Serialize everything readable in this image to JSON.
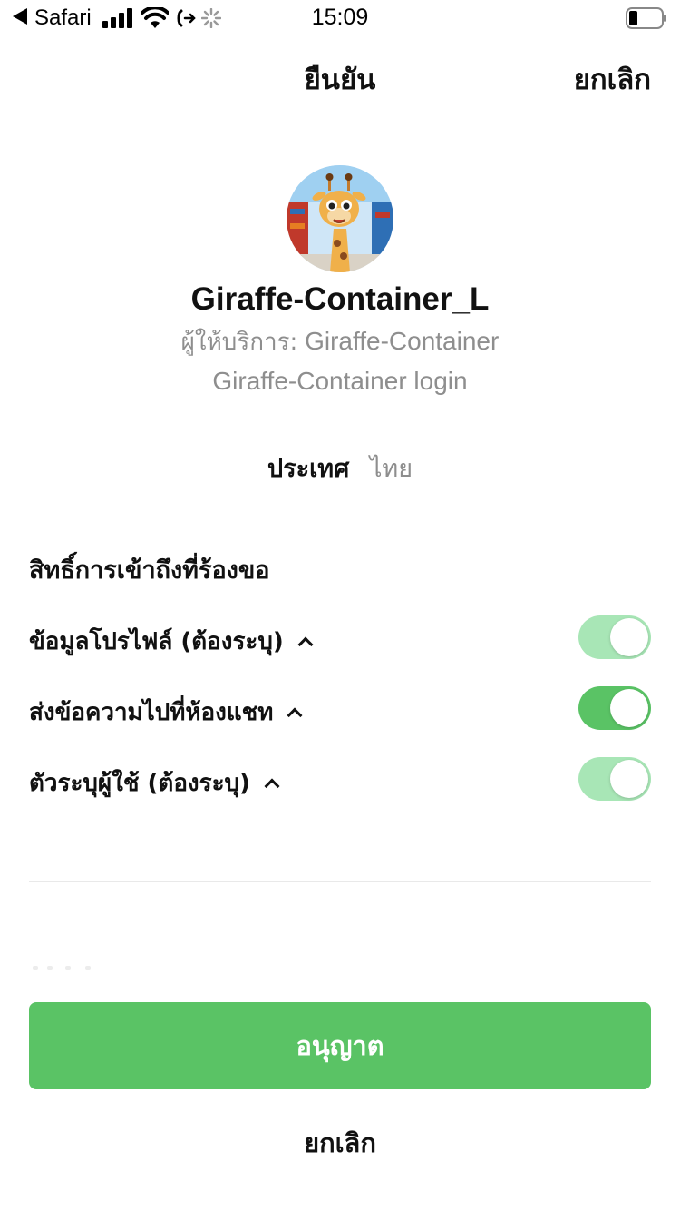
{
  "status_bar": {
    "back_app": "Safari",
    "time": "15:09",
    "icons": [
      "back-arrow-icon",
      "signal-icon",
      "wifi-icon",
      "call-forwarding-icon",
      "loading-spinner-icon",
      "battery-icon"
    ]
  },
  "nav": {
    "title": "ยืนยัน",
    "cancel_label": "ยกเลิก"
  },
  "app": {
    "name": "Giraffe-Container_L",
    "provider_label": "ผู้ให้บริการ:",
    "provider_name": "Giraffe-Container",
    "description": "Giraffe-Container login"
  },
  "country": {
    "label": "ประเทศ",
    "value": "ไทย"
  },
  "permissions": {
    "heading": "สิทธิ์การเข้าถึงที่ร้องขอ",
    "items": [
      {
        "label": "ข้อมูลโปรไฟล์ (ต้องระบุ)",
        "enabled": true,
        "required": true,
        "color": "#a8e6b6"
      },
      {
        "label": "ส่งข้อความไปที่ห้องแชท",
        "enabled": true,
        "required": false,
        "color": "#5ac365"
      },
      {
        "label": "ตัวระบุผู้ใช้ (ต้องระบุ)",
        "enabled": true,
        "required": true,
        "color": "#a8e6b6"
      }
    ]
  },
  "actions": {
    "allow_label": "อนุญาต",
    "cancel_label": "ยกเลิก"
  },
  "colors": {
    "primary_green": "#5ac365",
    "disabled_green": "#a8e6b6",
    "secondary_text": "#8e8e8e"
  }
}
